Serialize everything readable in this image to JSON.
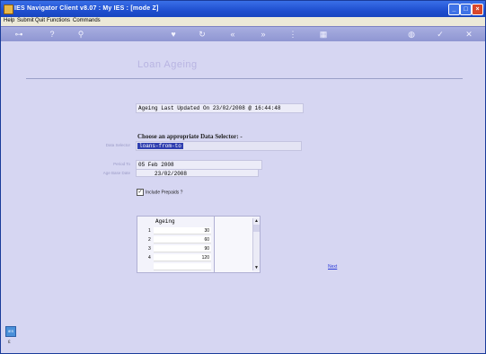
{
  "window": {
    "title": "IES Navigator Client v8.07 : My IES :      [mode Z]"
  },
  "menubar": [
    "Help",
    "Submit",
    "Quit",
    "Functions",
    "Commands"
  ],
  "toolbar": {
    "icons": [
      "key-icon",
      "help-icon",
      "search-icon",
      "heart-icon",
      "refresh-icon",
      "rewind-icon",
      "fast-forward-icon",
      "tree-icon",
      "grid-icon",
      "globe-icon",
      "check-icon",
      "close-icon"
    ]
  },
  "page": {
    "title": "Loan Ageing",
    "updated": "Ageing Last Updated On 23/02/2008 @ 16:44:48",
    "choose_label": "Choose an appropriate Data Selector: -",
    "data_selector_label": "Data Selector",
    "data_selector_value": "loans-from-to",
    "period_label": "Period To",
    "period_value": "05 Feb 2008",
    "age_base_label": "Age Base Date",
    "age_base_value": "23/02/2008",
    "include_prepaids_label": "Include Prepaids ?",
    "include_prepaids_checked": true,
    "next_label": "Next"
  },
  "ageing_grid": {
    "header": "Ageing",
    "rows": [
      {
        "num": "1",
        "value": "30"
      },
      {
        "num": "2",
        "value": "60"
      },
      {
        "num": "3",
        "value": "90"
      },
      {
        "num": "4",
        "value": "120"
      }
    ]
  }
}
